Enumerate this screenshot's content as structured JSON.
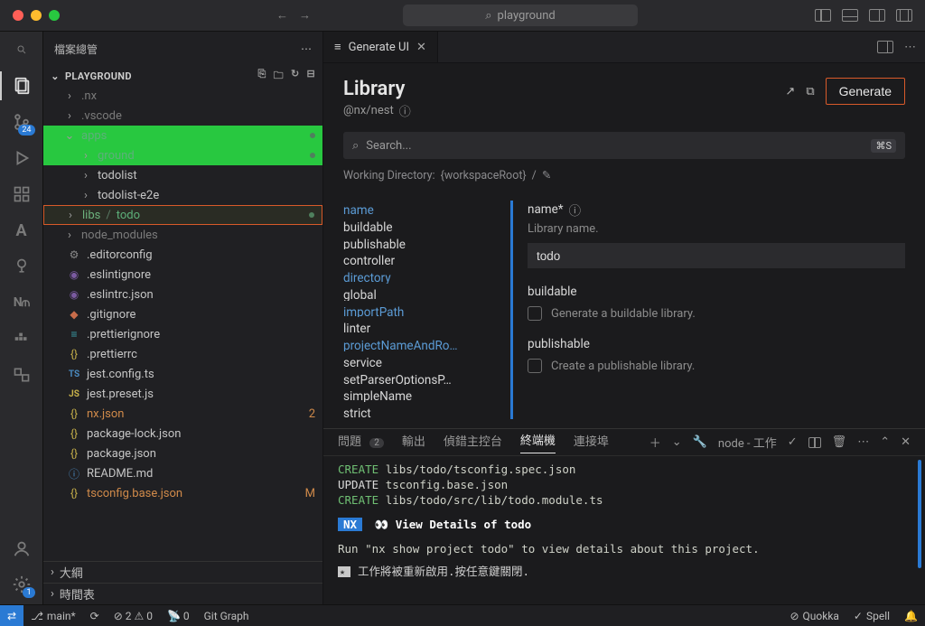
{
  "titlebar": {
    "search_text": "playground"
  },
  "activity": {
    "scm_badge": "24",
    "settings_badge": "1"
  },
  "explorer": {
    "title": "檔案總管",
    "root_label": "PLAYGROUND",
    "tree": {
      "nx": ".nx",
      "vscode": ".vscode",
      "apps": "apps",
      "ground": "ground",
      "todolist": "todolist",
      "todolist_e2e": "todolist-e2e",
      "libs": "libs",
      "libs_child": "todo",
      "node_modules": "node_modules",
      "editorconfig": ".editorconfig",
      "eslintignore": ".eslintignore",
      "eslintrc": ".eslintrc.json",
      "gitignore": ".gitignore",
      "prettierignore": ".prettierignore",
      "prettierrc": ".prettierrc",
      "jest_config": "jest.config.ts",
      "jest_preset": "jest.preset.js",
      "nx_json": "nx.json",
      "nx_json_count": "2",
      "package_lock": "package-lock.json",
      "package_json": "package.json",
      "readme": "README.md",
      "tsconfig": "tsconfig.base.json",
      "tsconfig_status": "M"
    },
    "outline": "大綱",
    "timeline": "時間表"
  },
  "tab": {
    "icon": "≡",
    "title": "Generate UI"
  },
  "generator": {
    "title": "Library",
    "subtitle": "@nx/nest",
    "generate_btn": "Generate",
    "search_placeholder": "Search...",
    "search_kbd": "⌘S",
    "workdir_label": "Working Directory:",
    "workdir_value": "{workspaceRoot}",
    "options": {
      "name": "name",
      "buildable": "buildable",
      "publishable": "publishable",
      "controller": "controller",
      "directory": "directory",
      "global": "global",
      "importPath": "importPath",
      "linter": "linter",
      "projectNameAndRo": "projectNameAndRo…",
      "service": "service",
      "setParserOptionsP": "setParserOptionsP…",
      "simpleName": "simpleName",
      "strict": "strict"
    },
    "form": {
      "name_label": "name*",
      "name_desc": "Library name.",
      "name_value": "todo",
      "buildable_label": "buildable",
      "buildable_desc": "Generate a buildable library.",
      "publishable_label": "publishable",
      "publishable_desc": "Create a publishable library."
    }
  },
  "panel": {
    "tabs": {
      "problems": "問題",
      "problems_count": "2",
      "output": "輸出",
      "debug": "偵錯主控台",
      "terminal": "終端機",
      "ports": "連接埠"
    },
    "toolbar": {
      "task": "node - 工作"
    },
    "lines": {
      "l1a": "CREATE",
      "l1b": "libs/todo/tsconfig.spec.json",
      "l2a": "UPDATE",
      "l2b": "tsconfig.base.json",
      "l3a": "CREATE",
      "l3b": "libs/todo/src/lib/todo.module.ts",
      "nx": "NX",
      "nxmsg": "View Details of todo",
      "run": "Run \"nx show project todo\" to view details about this project.",
      "foot": "工作將被重新啟用.按任意鍵關閉."
    }
  },
  "statusbar": {
    "remote": "⇄",
    "branch": "main*",
    "sync": "⟳",
    "err_warn": "⊘ 2 ⚠ 0",
    "radio": "📡 0",
    "gitgraph": "Git Graph",
    "quokka": "Quokka",
    "spell": "Spell"
  }
}
